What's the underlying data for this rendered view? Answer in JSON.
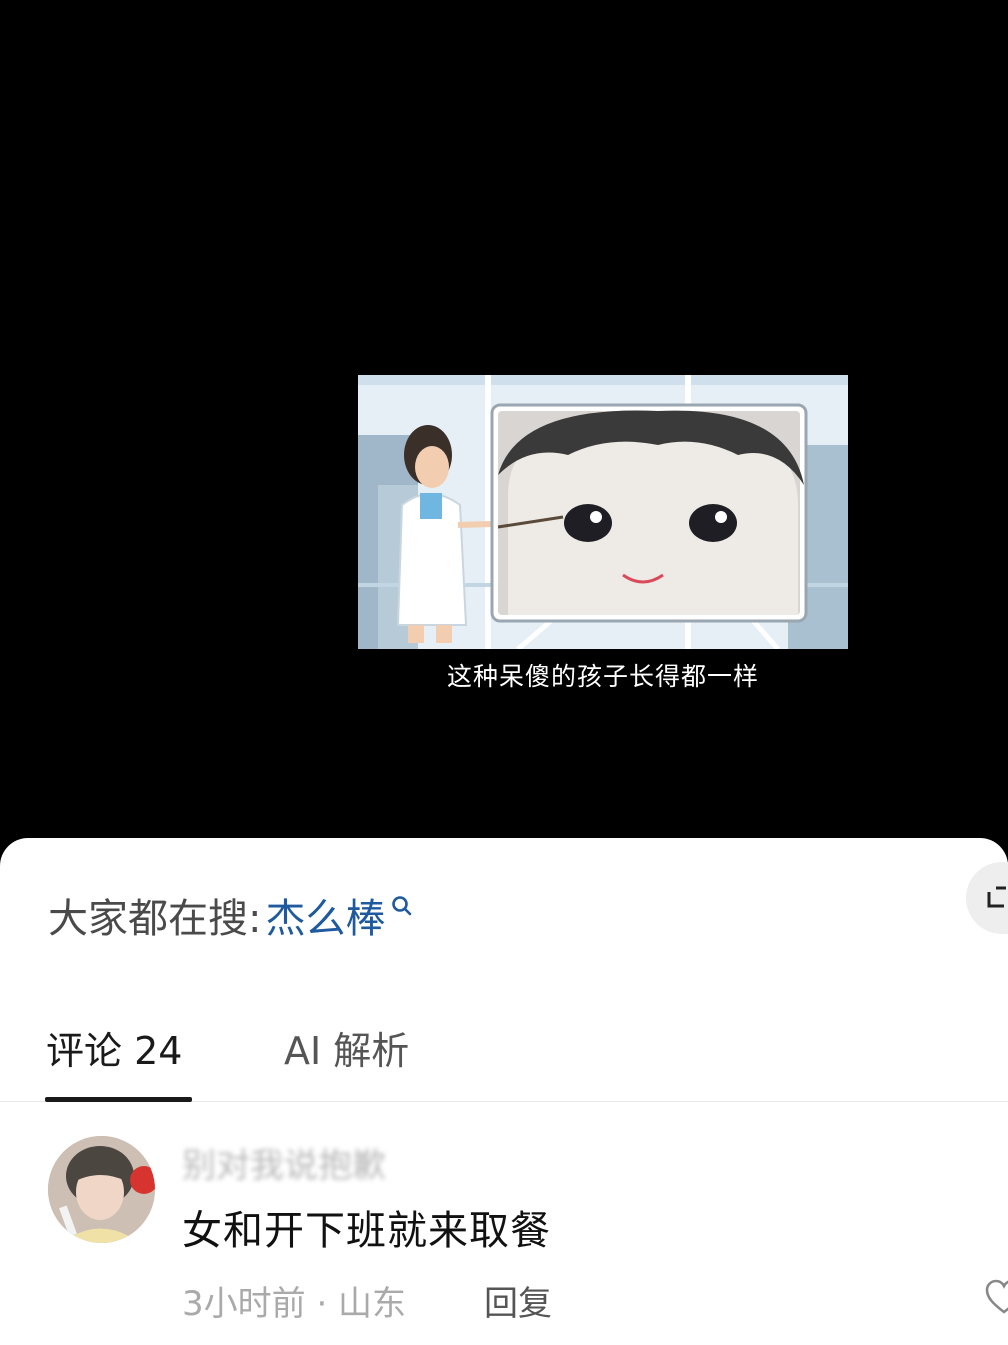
{
  "video": {
    "subtitle": "这种呆傻的孩子长得都一样"
  },
  "search": {
    "prefix": "大家都在搜:",
    "term": "杰么棒",
    "icon": "search-icon"
  },
  "tabs": [
    {
      "label": "评论 24",
      "active": true
    },
    {
      "label": "AI 解析",
      "active": false
    }
  ],
  "comments": [
    {
      "username": "别对我说抱歉",
      "text": "女和开下班就来取餐",
      "meta": "3小时前 · 山东",
      "reply_label": "回复"
    }
  ],
  "colors": {
    "search_term": "#1f5a9e",
    "tab_underline": "#1a1a1a"
  }
}
